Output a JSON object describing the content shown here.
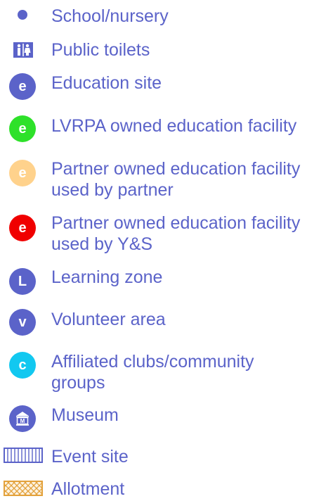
{
  "legend": {
    "items": [
      {
        "label": "School/nursery",
        "icon": "school-nursery-dot-icon",
        "color": "#5b63c9"
      },
      {
        "label": "Public toilets",
        "icon": "toilets-icon",
        "color": "#5b63c9"
      },
      {
        "label": "Education site",
        "icon": "education-site-icon",
        "letter": "e",
        "color": "#5b63c9"
      },
      {
        "label": "LVRPA owned education facility",
        "icon": "lvrpa-education-icon",
        "letter": "e",
        "color": "#2ee12a"
      },
      {
        "label": "Partner owned education facility\nused by partner",
        "icon": "partner-education-icon",
        "letter": "e",
        "color": "#ffd28c"
      },
      {
        "label": "Partner owned education facility\nused by Y&S",
        "icon": "partner-ys-education-icon",
        "letter": "e",
        "color": "#f00000"
      },
      {
        "label": "Learning zone",
        "icon": "learning-zone-icon",
        "letter": "L",
        "color": "#5b63c9"
      },
      {
        "label": "Volunteer area",
        "icon": "volunteer-area-icon",
        "letter": "v",
        "color": "#5b63c9"
      },
      {
        "label": "Affiliated clubs/community\ngroups",
        "icon": "affiliated-clubs-icon",
        "letter": "c",
        "color": "#12c8f0"
      },
      {
        "label": "Museum",
        "icon": "museum-icon",
        "color": "#5b63c9"
      },
      {
        "label": "Event site",
        "icon": "event-site-hatch-icon",
        "color": "#5b63c9"
      },
      {
        "label": "Allotment",
        "icon": "allotment-crosshatch-icon",
        "color": "#e3a23c"
      }
    ]
  }
}
